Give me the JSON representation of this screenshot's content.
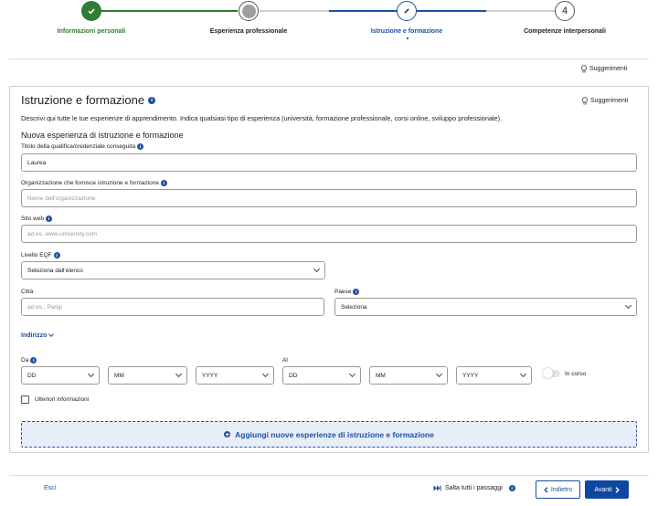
{
  "stepper": {
    "steps": [
      {
        "label": "Informazioni personali",
        "state": "completed",
        "icon": "check-icon"
      },
      {
        "label": "Esperienza professionale",
        "state": "visited",
        "icon": "grey-dot-icon"
      },
      {
        "label": "Istruzione e formazione",
        "state": "current",
        "icon": "pencil-icon"
      },
      {
        "label": "Competenze interpersonali",
        "state": "upcoming",
        "number": "4"
      }
    ],
    "colors": {
      "completed": "#2e7d32",
      "current": "#1d4fa3",
      "inactive": "#cfcfcf",
      "visited": "#9e9e9e"
    }
  },
  "top_suggestions_label": "Suggerimenti",
  "section": {
    "title": "Istruzione e formazione",
    "suggestions_label": "Suggerimenti",
    "description": "Descrivi qui tutte le tue esperienze di apprendimento. Indica qualsiasi tipo di esperienza (università, formazione professionale, corsi online, sviluppo professionale).",
    "subheading": "Nuova esperienza di istruzione e formazione"
  },
  "fields": {
    "qualification": {
      "label": "Titolo della qualifica/credenziale conseguita",
      "value": "Laurea"
    },
    "organization": {
      "label": "Organizzazione che fornisce istruzione e formazione",
      "placeholder": "Nome dell'organizzazione"
    },
    "website": {
      "label": "Sito web",
      "placeholder": "ad es. www.university.com"
    },
    "eqf": {
      "label": "Livello EQF",
      "selected": "Seleziona dall'elenco"
    },
    "city": {
      "label": "Città",
      "placeholder": "ad es.: Parigi"
    },
    "country": {
      "label": "Paese",
      "selected": "Seleziona"
    }
  },
  "address_toggle": "Indirizzo",
  "dates": {
    "from_label": "Da",
    "to_label": "Al",
    "from": {
      "day": "DD",
      "month": "MM",
      "year": "YYYY"
    },
    "to": {
      "day": "DD",
      "month": "MM",
      "year": "YYYY"
    },
    "ongoing_label": "In corso"
  },
  "more_info_label": "Ulteriori informazioni",
  "add_button_label": "Aggiungi nuove esperienze di istruzione e formazione",
  "footer": {
    "exit": "Esci",
    "skip_all": "Salta tutti i passaggi",
    "back": "Indietro",
    "next": "Avanti"
  }
}
